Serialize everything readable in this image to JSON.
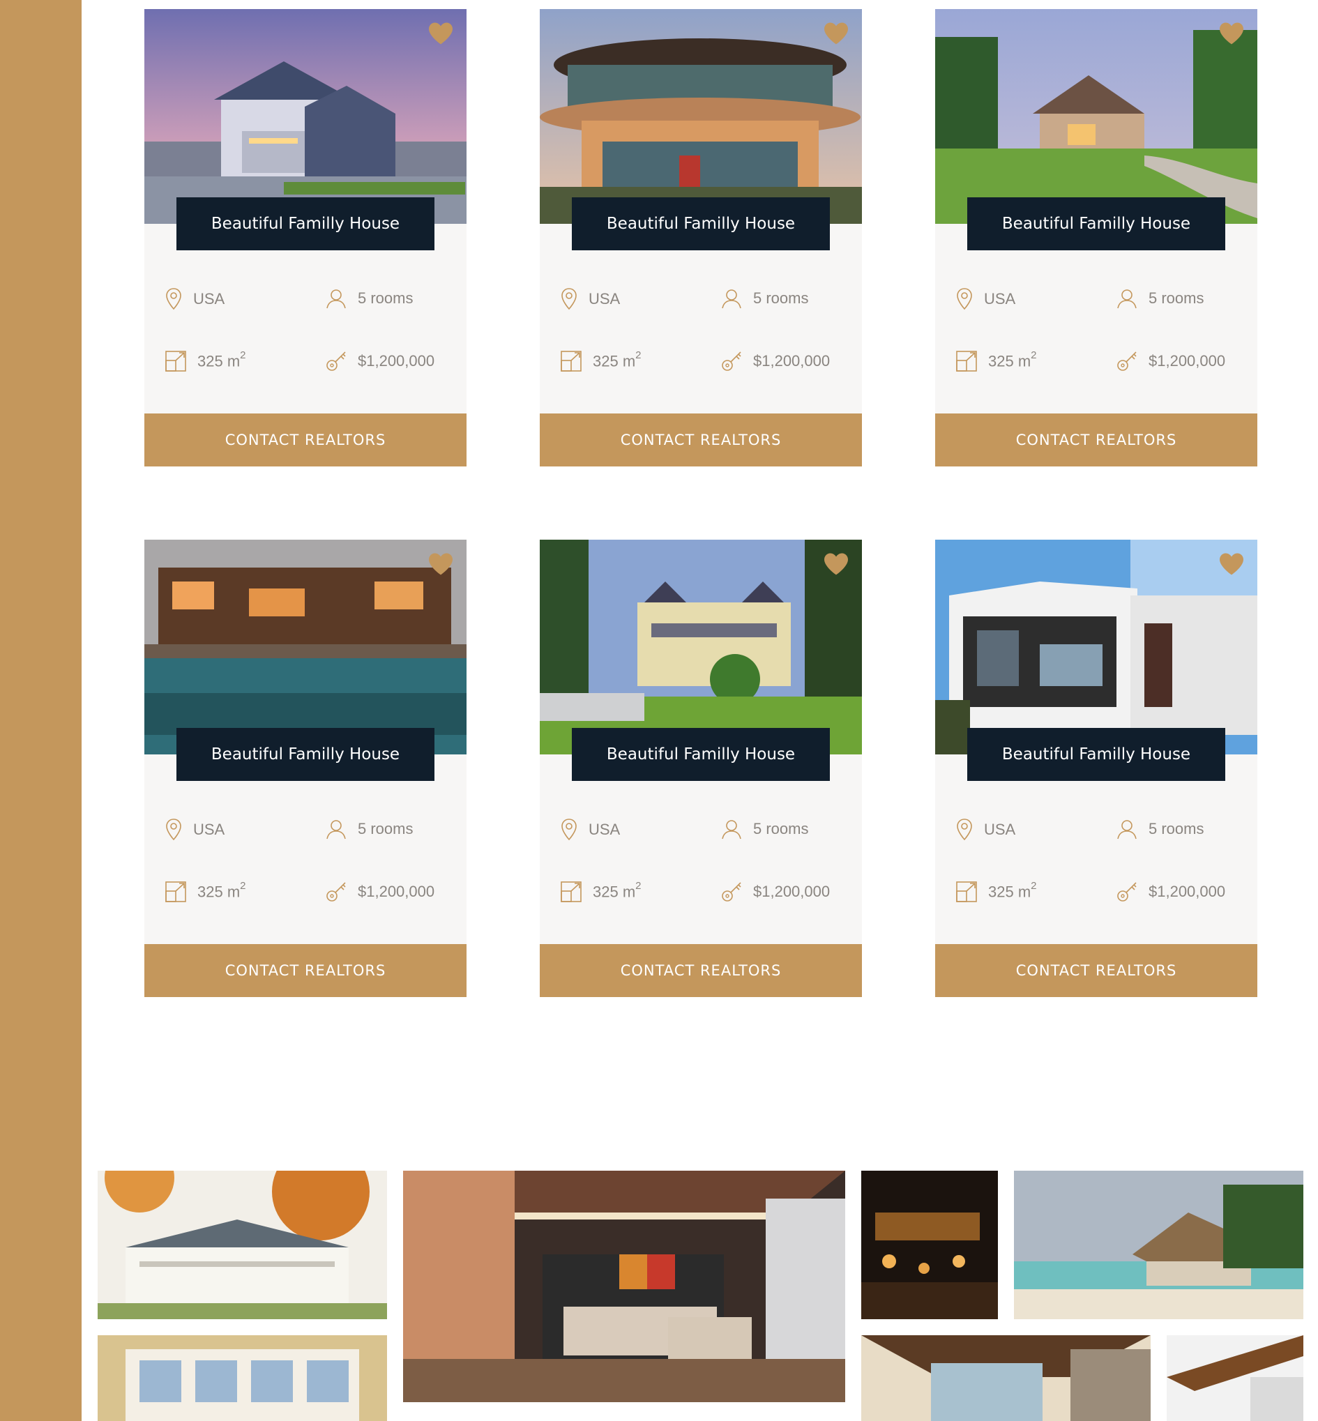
{
  "colors": {
    "accent": "#c4975c",
    "title_bg": "#101e2c",
    "card_bg": "#f7f6f5",
    "meta_text": "#8a8580"
  },
  "listings": [
    {
      "title": "Beautiful Familly House",
      "location": "USA",
      "rooms": "5 rooms",
      "area": "325 m",
      "area_unit_sup": "2",
      "price": "$1,200,000",
      "cta": "CONTACT REALTORS"
    },
    {
      "title": "Beautiful Familly House",
      "location": "USA",
      "rooms": "5 rooms",
      "area": "325 m",
      "area_unit_sup": "2",
      "price": "$1,200,000",
      "cta": "CONTACT REALTORS"
    },
    {
      "title": "Beautiful Familly House",
      "location": "USA",
      "rooms": "5 rooms",
      "area": "325 m",
      "area_unit_sup": "2",
      "price": "$1,200,000",
      "cta": "CONTACT REALTORS"
    },
    {
      "title": "Beautiful Familly House",
      "location": "USA",
      "rooms": "5 rooms",
      "area": "325 m",
      "area_unit_sup": "2",
      "price": "$1,200,000",
      "cta": "CONTACT REALTORS"
    },
    {
      "title": "Beautiful Familly House",
      "location": "USA",
      "rooms": "5 rooms",
      "area": "325 m",
      "area_unit_sup": "2",
      "price": "$1,200,000",
      "cta": "CONTACT REALTORS"
    },
    {
      "title": "Beautiful Familly House",
      "location": "USA",
      "rooms": "5 rooms",
      "area": "325 m",
      "area_unit_sup": "2",
      "price": "$1,200,000",
      "cta": "CONTACT REALTORS"
    }
  ],
  "icons": {
    "location": "location-pin-icon",
    "rooms": "person-icon",
    "area": "area-expand-icon",
    "price": "key-icon",
    "favorite": "heart-icon"
  }
}
